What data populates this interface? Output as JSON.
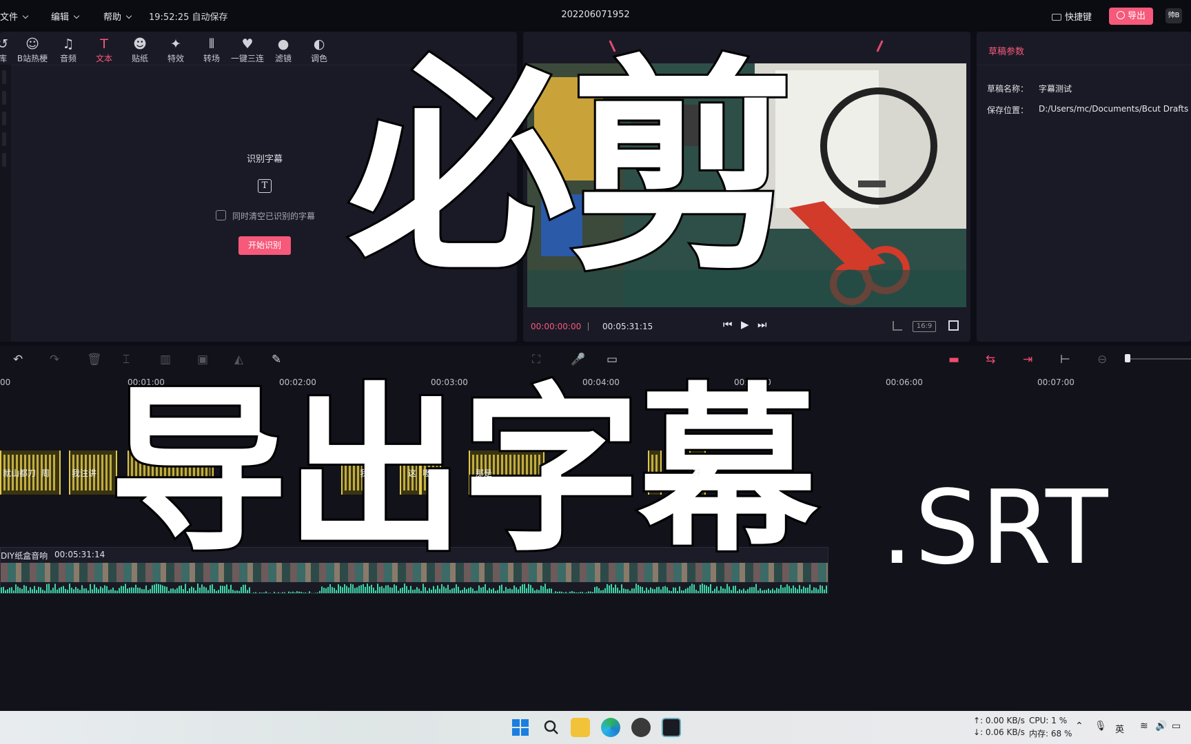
{
  "topbar": {
    "menus": [
      "文件",
      "编辑",
      "帮助"
    ],
    "autosave": "19:52:25 自动保存",
    "project_title": "202206071952",
    "shortcut_label": "快捷键",
    "export_label": "导出",
    "avatar_label": "帅B"
  },
  "tools": [
    {
      "label": "库",
      "icon": "↺",
      "name": "media-library-icon"
    },
    {
      "label": "B站热梗",
      "icon": "☺",
      "name": "bilibili-meme-icon"
    },
    {
      "label": "音频",
      "icon": "♫",
      "name": "music-note-icon"
    },
    {
      "label": "文本",
      "icon": "T",
      "name": "text-icon"
    },
    {
      "label": "贴纸",
      "icon": "☻",
      "name": "sticker-icon"
    },
    {
      "label": "特效",
      "icon": "✦",
      "name": "effects-star-icon"
    },
    {
      "label": "转场",
      "icon": "⦀",
      "name": "transition-icon"
    },
    {
      "label": "一键三连",
      "icon": "♥",
      "name": "thumbs-up-icon"
    },
    {
      "label": "滤镜",
      "icon": "●",
      "name": "filter-icon"
    },
    {
      "label": "调色",
      "icon": "◐",
      "name": "palette-icon"
    }
  ],
  "recognize": {
    "title": "识别字幕",
    "icon_glyph": "T",
    "clear_label": "同时清空已识别的字幕",
    "start_button": "开始识别"
  },
  "player": {
    "current_time": "00:00:00:00",
    "duration": "00:05:31:15",
    "ratio": "16:9"
  },
  "params": {
    "title": "草稿参数",
    "name_key": "草稿名称：",
    "name_value": "字幕测试",
    "path_key": "保存位置：",
    "path_value": "D:/Users/mc/Documents/Bcut Drafts"
  },
  "timeline": {
    "ticks": [
      "00",
      "00:01:00",
      "00:02:00",
      "00:03:00",
      "00:04:00",
      "00:05:00",
      "00:06:00",
      "00:07:00"
    ],
    "subtitle_snippets": [
      "就山都刀",
      "周",
      "我注讲",
      "我",
      "这",
      "嗷",
      "那是",
      "开"
    ],
    "video_clip_name": "DIY纸盒音响",
    "video_clip_duration": "00:05:31:14"
  },
  "overlay": {
    "title_top": "必剪",
    "title_bottom": "导出字幕",
    "title_suffix": ".SRT"
  },
  "taskbar": {
    "net_up": "↑: 0.00 KB/s",
    "net_down": "↓: 0.06 KB/s",
    "cpu": "CPU: 1 %",
    "memory": "内存: 68 %",
    "ime": "英"
  },
  "colors": {
    "accent": "#f6597a",
    "panel_bg": "#1a1a26",
    "subtitle_clip": "#d9c24a",
    "waveform": "#3fd6a8"
  }
}
